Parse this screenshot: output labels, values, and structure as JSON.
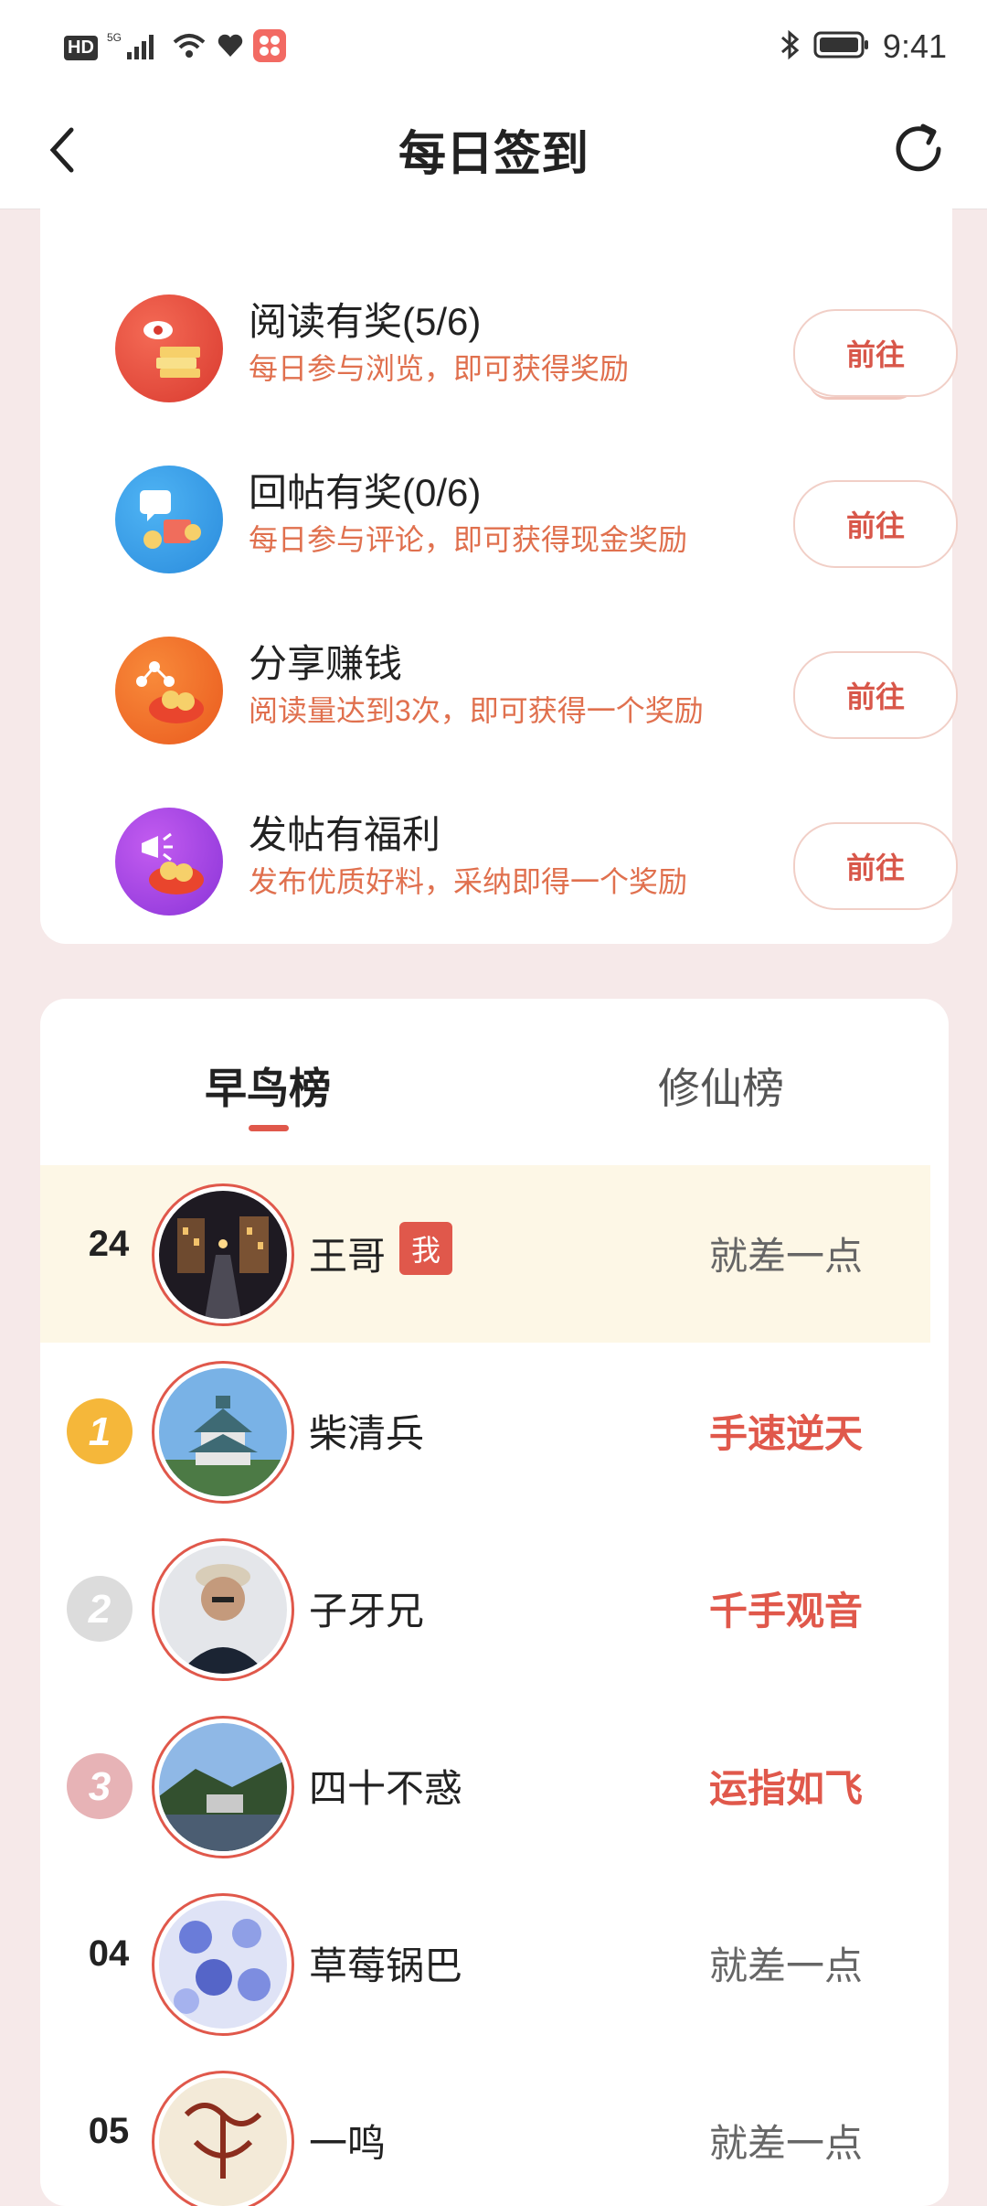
{
  "status_bar": {
    "hd": "HD",
    "network": "5G",
    "time": "9:41"
  },
  "header": {
    "title": "每日签到"
  },
  "tasks": [
    {
      "title": "阅读有奖(5/6)",
      "desc": "每日参与浏览，即可获得奖励",
      "button": "前往",
      "icon": "read-reward-icon"
    },
    {
      "title": "回帖有奖(0/6)",
      "desc": "每日参与评论，即可获得现金奖励",
      "button": "前往",
      "icon": "reply-reward-icon"
    },
    {
      "title": "分享赚钱",
      "desc": "阅读量达到3次，即可获得一个奖励",
      "button": "前往",
      "icon": "share-earn-icon"
    },
    {
      "title": "发帖有福利",
      "desc": "发布优质好料，采纳即得一个奖励",
      "button": "前往",
      "icon": "post-welfare-icon"
    }
  ],
  "ranking": {
    "tabs": [
      "早鸟榜",
      "修仙榜"
    ],
    "active_tab": "早鸟榜",
    "me": {
      "rank": "24",
      "name": "王哥",
      "badge": "我",
      "status": "就差一点"
    },
    "rows": [
      {
        "rank": "1",
        "name": "柴清兵",
        "status": "手速逆天"
      },
      {
        "rank": "2",
        "name": "子牙兄",
        "status": "千手观音"
      },
      {
        "rank": "3",
        "name": "四十不惑",
        "status": "运指如飞"
      },
      {
        "rank": "04",
        "name": "草莓锅巴",
        "status": "就差一点"
      },
      {
        "rank": "05",
        "name": "一鸣",
        "status": "就差一点"
      }
    ]
  },
  "colors": {
    "accent": "#e0584b",
    "desc": "#e0704e",
    "me_row_bg": "#fdf7e6",
    "page_bg": "#f6e9e9"
  }
}
